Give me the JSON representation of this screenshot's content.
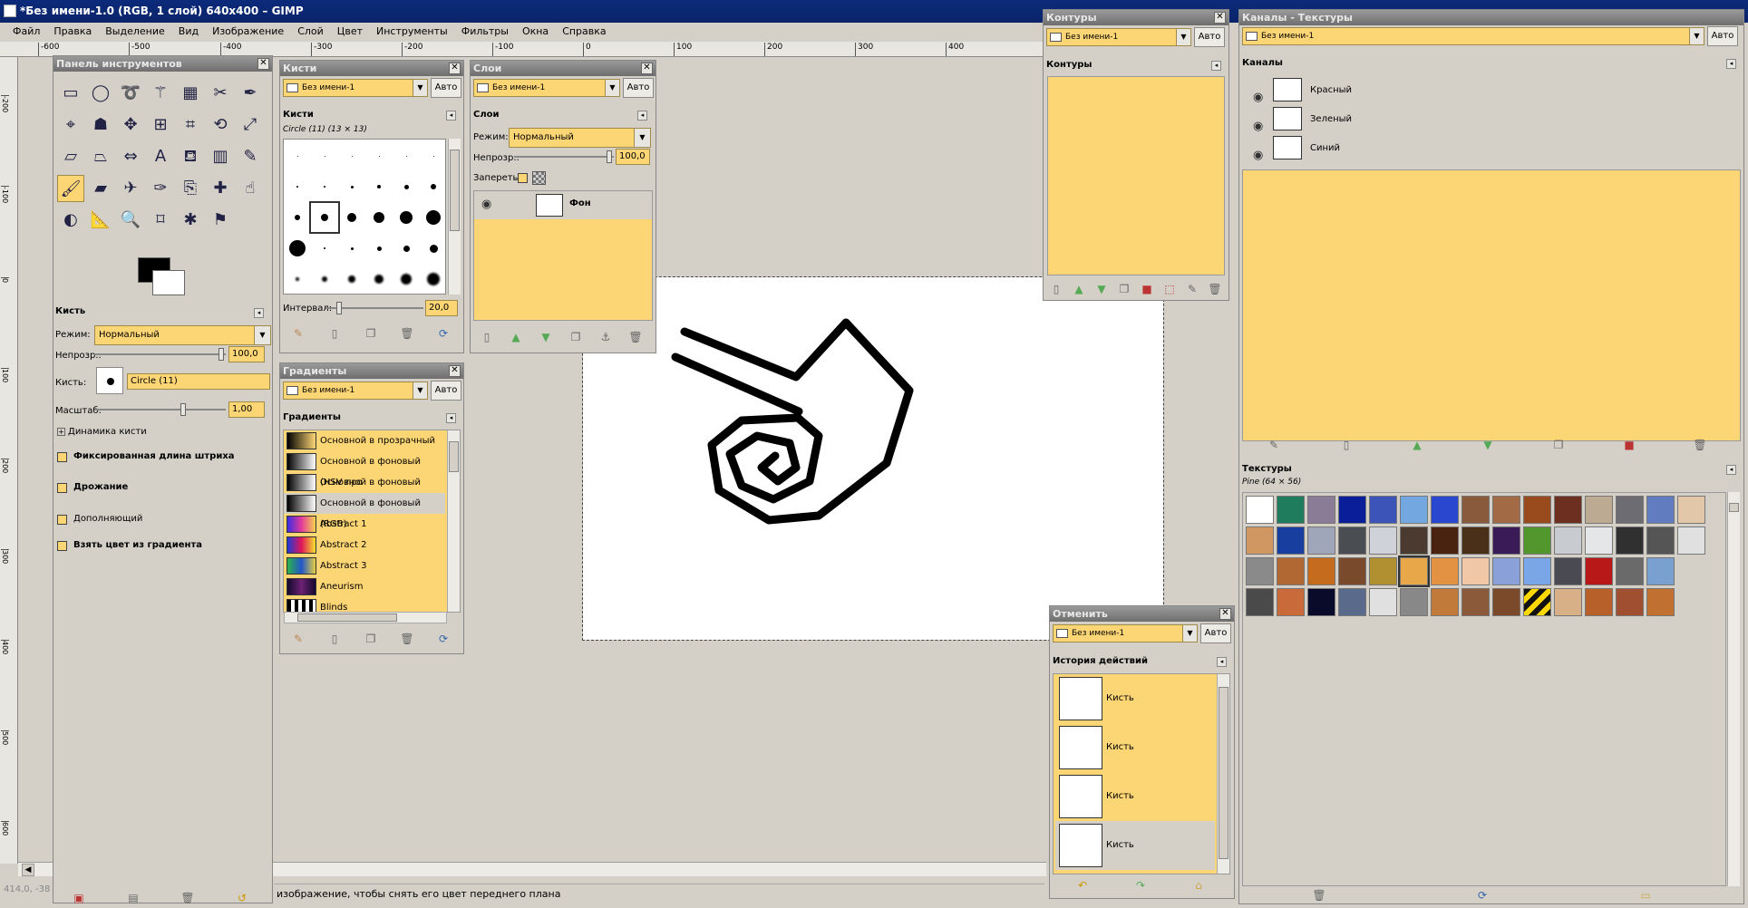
{
  "window": {
    "title": "*Без имени-1.0 (RGB, 1 слой) 640x400 – GIMP"
  },
  "menu": [
    "Файл",
    "Правка",
    "Выделение",
    "Вид",
    "Изображение",
    "Слой",
    "Цвет",
    "Инструменты",
    "Фильтры",
    "Окна",
    "Справка"
  ],
  "hruler": [
    "-600",
    "-500",
    "-400",
    "-300",
    "-200",
    "-100",
    "0",
    "100",
    "200",
    "300",
    "400"
  ],
  "vruler": [
    "-200",
    "-100",
    "0",
    "100",
    "200",
    "300",
    "400",
    "500",
    "600"
  ],
  "status": {
    "coords": "414,0, -38",
    "message": "изображение, чтобы снять его цвет переднего плана"
  },
  "colors": {
    "accent": "#fcd575",
    "title_bg": "#0a246a",
    "panel": "#d4d0c8"
  },
  "toolbox": {
    "title": "Панель инструментов",
    "tools": [
      "rect-select-icon",
      "ellipse-select-icon",
      "lasso-icon",
      "magic-wand-icon",
      "select-by-color-icon",
      "scissors-icon",
      "paths-icon",
      "color-picker-icon",
      "foreground-select-icon",
      "move-icon",
      "align-icon",
      "crop-icon",
      "rotate-icon",
      "scale-icon",
      "shear-icon",
      "perspective-icon",
      "flip-icon",
      "text-icon",
      "bucket-fill-icon",
      "blend-icon",
      "pencil-icon",
      "paintbrush-icon",
      "eraser-icon",
      "airbrush-icon",
      "ink-icon",
      "clone-icon",
      "heal-icon",
      "smudge-icon",
      "dodge-icon",
      "measure-icon",
      "zoom-icon",
      "cage-icon",
      "warp-icon",
      "stamp-icon"
    ],
    "options": {
      "title": "Кисть",
      "mode_label": "Режим:",
      "mode_value": "Нормальный",
      "opacity_label": "Непрозр.:",
      "opacity_value": "100,0",
      "brush_label": "Кисть:",
      "brush_value": "Circle (11)",
      "scale_label": "Масштаб:",
      "scale_value": "1,00",
      "dynamics_label": "Динамика кисти",
      "fixed_length": "Фиксированная длина штриха",
      "jitter": "Дрожание",
      "incremental": "Дополняющий",
      "use_gradient": "Взять цвет из градиента"
    }
  },
  "brushes": {
    "title": "Кисти",
    "image": "Без имени-1",
    "auto": "Авто",
    "section": "Кисти",
    "current": "Circle (11) (13 × 13)",
    "spacing_label": "Интервал:",
    "spacing_value": "20,0"
  },
  "layers": {
    "title": "Слои",
    "image": "Без имени-1",
    "auto": "Авто",
    "section": "Слои",
    "mode_label": "Режим:",
    "mode_value": "Нормальный",
    "opacity_label": "Непрозр.:",
    "opacity_value": "100,0",
    "lock_label": "Запереть:",
    "layer_name": "Фон"
  },
  "gradients": {
    "title": "Градиенты",
    "image": "Без имени-1",
    "auto": "Авто",
    "section": "Градиенты",
    "items": [
      {
        "name": "Основной в прозрачный",
        "css": "linear-gradient(90deg,#000,rgba(0,0,0,0))"
      },
      {
        "name": "Основной в фоновый  (HSV про",
        "css": "linear-gradient(90deg,#000,#fff)"
      },
      {
        "name": "Основной в фоновый (HSV по ч",
        "css": "linear-gradient(90deg,#000,#fff)"
      },
      {
        "name": "Основной в фоновый (RGB)",
        "css": "linear-gradient(90deg,#000,#fff)"
      },
      {
        "name": "Abstract 1",
        "css": "linear-gradient(90deg,#3b2ce0,#e33a9b,#f6d34d)"
      },
      {
        "name": "Abstract 2",
        "css": "linear-gradient(90deg,#1d3ad6,#e2165a,#f5e22c)"
      },
      {
        "name": "Abstract 3",
        "css": "linear-gradient(90deg,#2db34a,#2156c9,#e8d040)"
      },
      {
        "name": "Aneurism",
        "css": "linear-gradient(90deg,#14082e,#6b2272,#14082e)"
      },
      {
        "name": "Blinds",
        "css": "repeating-linear-gradient(90deg,#000 0 4px,#fff 4px 8px)"
      }
    ]
  },
  "paths": {
    "title": "Контуры",
    "image": "Без имени-1",
    "auto": "Авто",
    "section": "Контуры"
  },
  "channels": {
    "title": "Каналы - Текстуры",
    "image": "Без имени-1",
    "auto": "Авто",
    "section": "Каналы",
    "items": [
      "Красный",
      "Зеленый",
      "Синий"
    ]
  },
  "textures": {
    "section": "Текстуры",
    "current": "Pine (64 × 56)",
    "swatches": [
      "#ffffff",
      "#1f7c5d",
      "#8a7b96",
      "#0a1e9a",
      "#3c54b8",
      "#73a7e0",
      "#2a48cf",
      "#8a5a3c",
      "#a26b45",
      "#9a4b1e",
      "#6d2f1f",
      "#bcaa92",
      "#6c6c72",
      "#617cbf",
      "#e2c7a9",
      "#d19762",
      "#183f9f",
      "#9fa6b9",
      "#4a4d52",
      "#cfd2d8",
      "#4a3a30",
      "#4a2210",
      "#4a3018",
      "#3a1b58",
      "#52962e",
      "#c8ccd0",
      "#e4e6e8",
      "#303030",
      "#555555",
      "#e0e0e0",
      "#8a8a8a",
      "#b26832",
      "#c46b1e",
      "#7a4a2c",
      "#b09030",
      "#e8a84a",
      "#e29242",
      "#f0c8a8",
      "#8aa0d8",
      "#7aa6e8",
      "#4a4a52",
      "#b81818",
      "#6a6a6a",
      "#7aa0d0",
      "",
      "#4a4a4a",
      "#c86a3a",
      "#0a0a2a",
      "#5a6a8a",
      "#e0e0e0",
      "#888888",
      "#c27a3a",
      "#8a5a3a",
      "#7a4a2a",
      "#ffd700",
      "#d8b088",
      "#b8602a",
      "#a05030",
      "#c07030",
      ""
    ]
  },
  "undo": {
    "title": "Отменить",
    "image": "Без имени-1",
    "auto": "Авто",
    "section": "История действий",
    "items": [
      "Кисть",
      "Кисть",
      "Кисть",
      "Кисть"
    ]
  }
}
